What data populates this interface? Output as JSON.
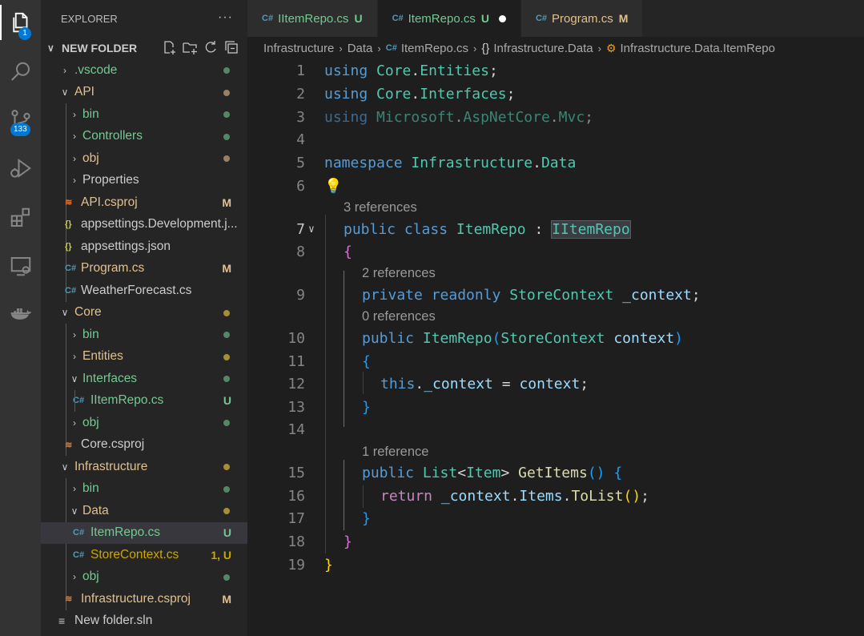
{
  "activity_bar": {
    "explorer_badge": "1",
    "scm_badge": "133"
  },
  "explorer": {
    "title": "EXPLORER",
    "more": "···",
    "folder_name": "NEW FOLDER",
    "tree": [
      {
        "label": ".vscode",
        "status": "",
        "dot": true
      },
      {
        "label": "API",
        "status": "",
        "dot": true
      },
      {
        "label": "bin",
        "status": "",
        "dot": true
      },
      {
        "label": "Controllers",
        "status": "",
        "dot": true
      },
      {
        "label": "obj",
        "status": "",
        "dot": true
      },
      {
        "label": "Properties",
        "status": "",
        "dot": false
      },
      {
        "label": "API.csproj",
        "status": "M",
        "dot": false
      },
      {
        "label": "appsettings.Development.j...",
        "status": "",
        "dot": false
      },
      {
        "label": "appsettings.json",
        "status": "",
        "dot": false
      },
      {
        "label": "Program.cs",
        "status": "M",
        "dot": false
      },
      {
        "label": "WeatherForecast.cs",
        "status": "",
        "dot": false
      },
      {
        "label": "Core",
        "status": "",
        "dot": true
      },
      {
        "label": "bin",
        "status": "",
        "dot": true
      },
      {
        "label": "Entities",
        "status": "",
        "dot": true
      },
      {
        "label": "Interfaces",
        "status": "",
        "dot": true
      },
      {
        "label": "IItemRepo.cs",
        "status": "U",
        "dot": false
      },
      {
        "label": "obj",
        "status": "",
        "dot": true
      },
      {
        "label": "Core.csproj",
        "status": "",
        "dot": false
      },
      {
        "label": "Infrastructure",
        "status": "",
        "dot": true
      },
      {
        "label": "bin",
        "status": "",
        "dot": true
      },
      {
        "label": "Data",
        "status": "",
        "dot": true
      },
      {
        "label": "ItemRepo.cs",
        "status": "U",
        "dot": false
      },
      {
        "label": "StoreContext.cs",
        "status": "1, U",
        "dot": false
      },
      {
        "label": "obj",
        "status": "",
        "dot": true
      },
      {
        "label": "Infrastructure.csproj",
        "status": "M",
        "dot": false
      },
      {
        "label": "New folder.sln",
        "status": "",
        "dot": false
      }
    ]
  },
  "tabs": [
    {
      "label": "IItemRepo.cs",
      "status": "U"
    },
    {
      "label": "ItemRepo.cs",
      "status": "U"
    },
    {
      "label": "Program.cs",
      "status": "M"
    }
  ],
  "breadcrumb": [
    "Infrastructure",
    "Data",
    "ItemRepo.cs",
    "Infrastructure.Data",
    "Infrastructure.Data.ItemRepo"
  ],
  "code_lens": [
    "3 references",
    "2 references",
    "0 references",
    "1 reference"
  ],
  "code": {
    "line_numbers": [
      "1",
      "2",
      "3",
      "4",
      "5",
      "6",
      "7",
      "8",
      "9",
      "10",
      "11",
      "12",
      "13",
      "14",
      "15",
      "16",
      "17",
      "18",
      "19"
    ],
    "l1": [
      "using",
      "Core",
      ".",
      "Entities",
      ";"
    ],
    "l2": [
      "using",
      "Core",
      ".",
      "Interfaces",
      ";"
    ],
    "l3": [
      "using",
      "Microsoft",
      ".",
      "AspNetCore",
      ".",
      "Mvc",
      ";"
    ],
    "l5": [
      "namespace",
      "Infrastructure",
      ".",
      "Data"
    ],
    "l7": [
      "public",
      "class",
      "ItemRepo",
      ":",
      "IItemRepo"
    ],
    "l8": [
      "{"
    ],
    "l9": [
      "private",
      "readonly",
      "StoreContext",
      "_context",
      ";"
    ],
    "l10": [
      "public",
      "ItemRepo",
      "(",
      "StoreContext",
      "context",
      ")"
    ],
    "l11": [
      "{"
    ],
    "l12": [
      "this",
      ".",
      "_context",
      "=",
      "context",
      ";"
    ],
    "l13": [
      "}"
    ],
    "l15": [
      "public",
      "List",
      "<",
      "Item",
      ">",
      "GetItems",
      "()",
      "{"
    ],
    "l16": [
      "return",
      "_context",
      ".",
      "Items",
      ".",
      "ToList",
      "()",
      ";"
    ],
    "l17": [
      "}"
    ],
    "l18": [
      "}"
    ],
    "l19": [
      "}"
    ]
  },
  "colors": {
    "modified": "#e2c08d",
    "untracked": "#73c991",
    "csharp_icon": "#519aba",
    "json_icon": "#cbcb41",
    "rss_icon": "#e37933"
  }
}
